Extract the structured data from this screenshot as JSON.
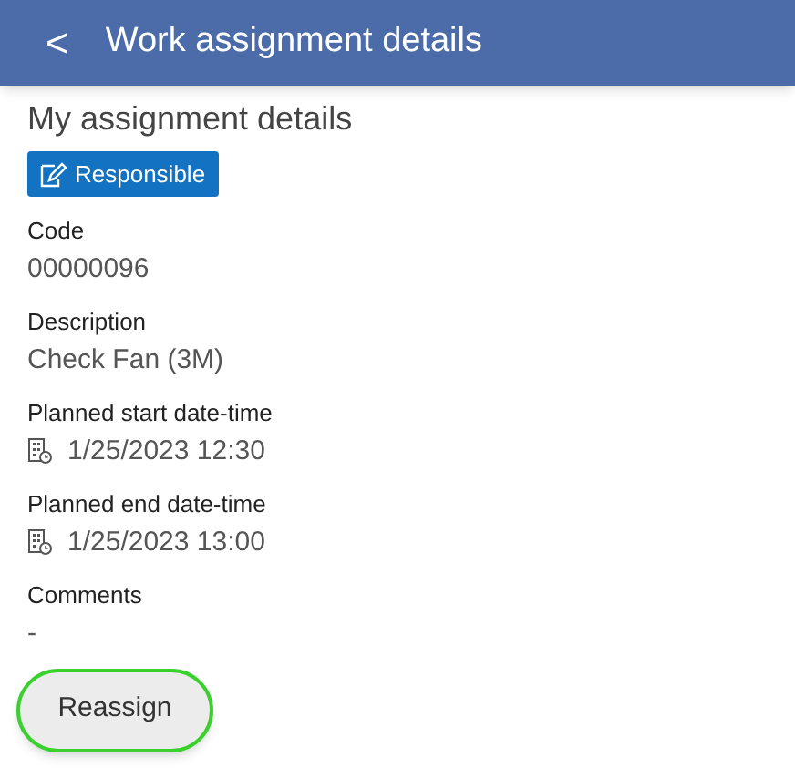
{
  "header": {
    "back": "<",
    "title": "Work assignment details"
  },
  "section_title": "My assignment details",
  "badge": "Responsible",
  "fields": [
    {
      "label": "Code",
      "value": "00000096",
      "kind": "text"
    },
    {
      "label": "Description",
      "value": "Check Fan (3M)",
      "kind": "text"
    },
    {
      "label": "Planned start date-time",
      "value": "1/25/2023 12:30",
      "kind": "datetime"
    },
    {
      "label": "Planned end date-time",
      "value": "1/25/2023 13:00",
      "kind": "datetime"
    },
    {
      "label": "Comments",
      "value": "-",
      "kind": "text"
    }
  ],
  "button": {
    "label": "Reassign",
    "focused": true
  }
}
